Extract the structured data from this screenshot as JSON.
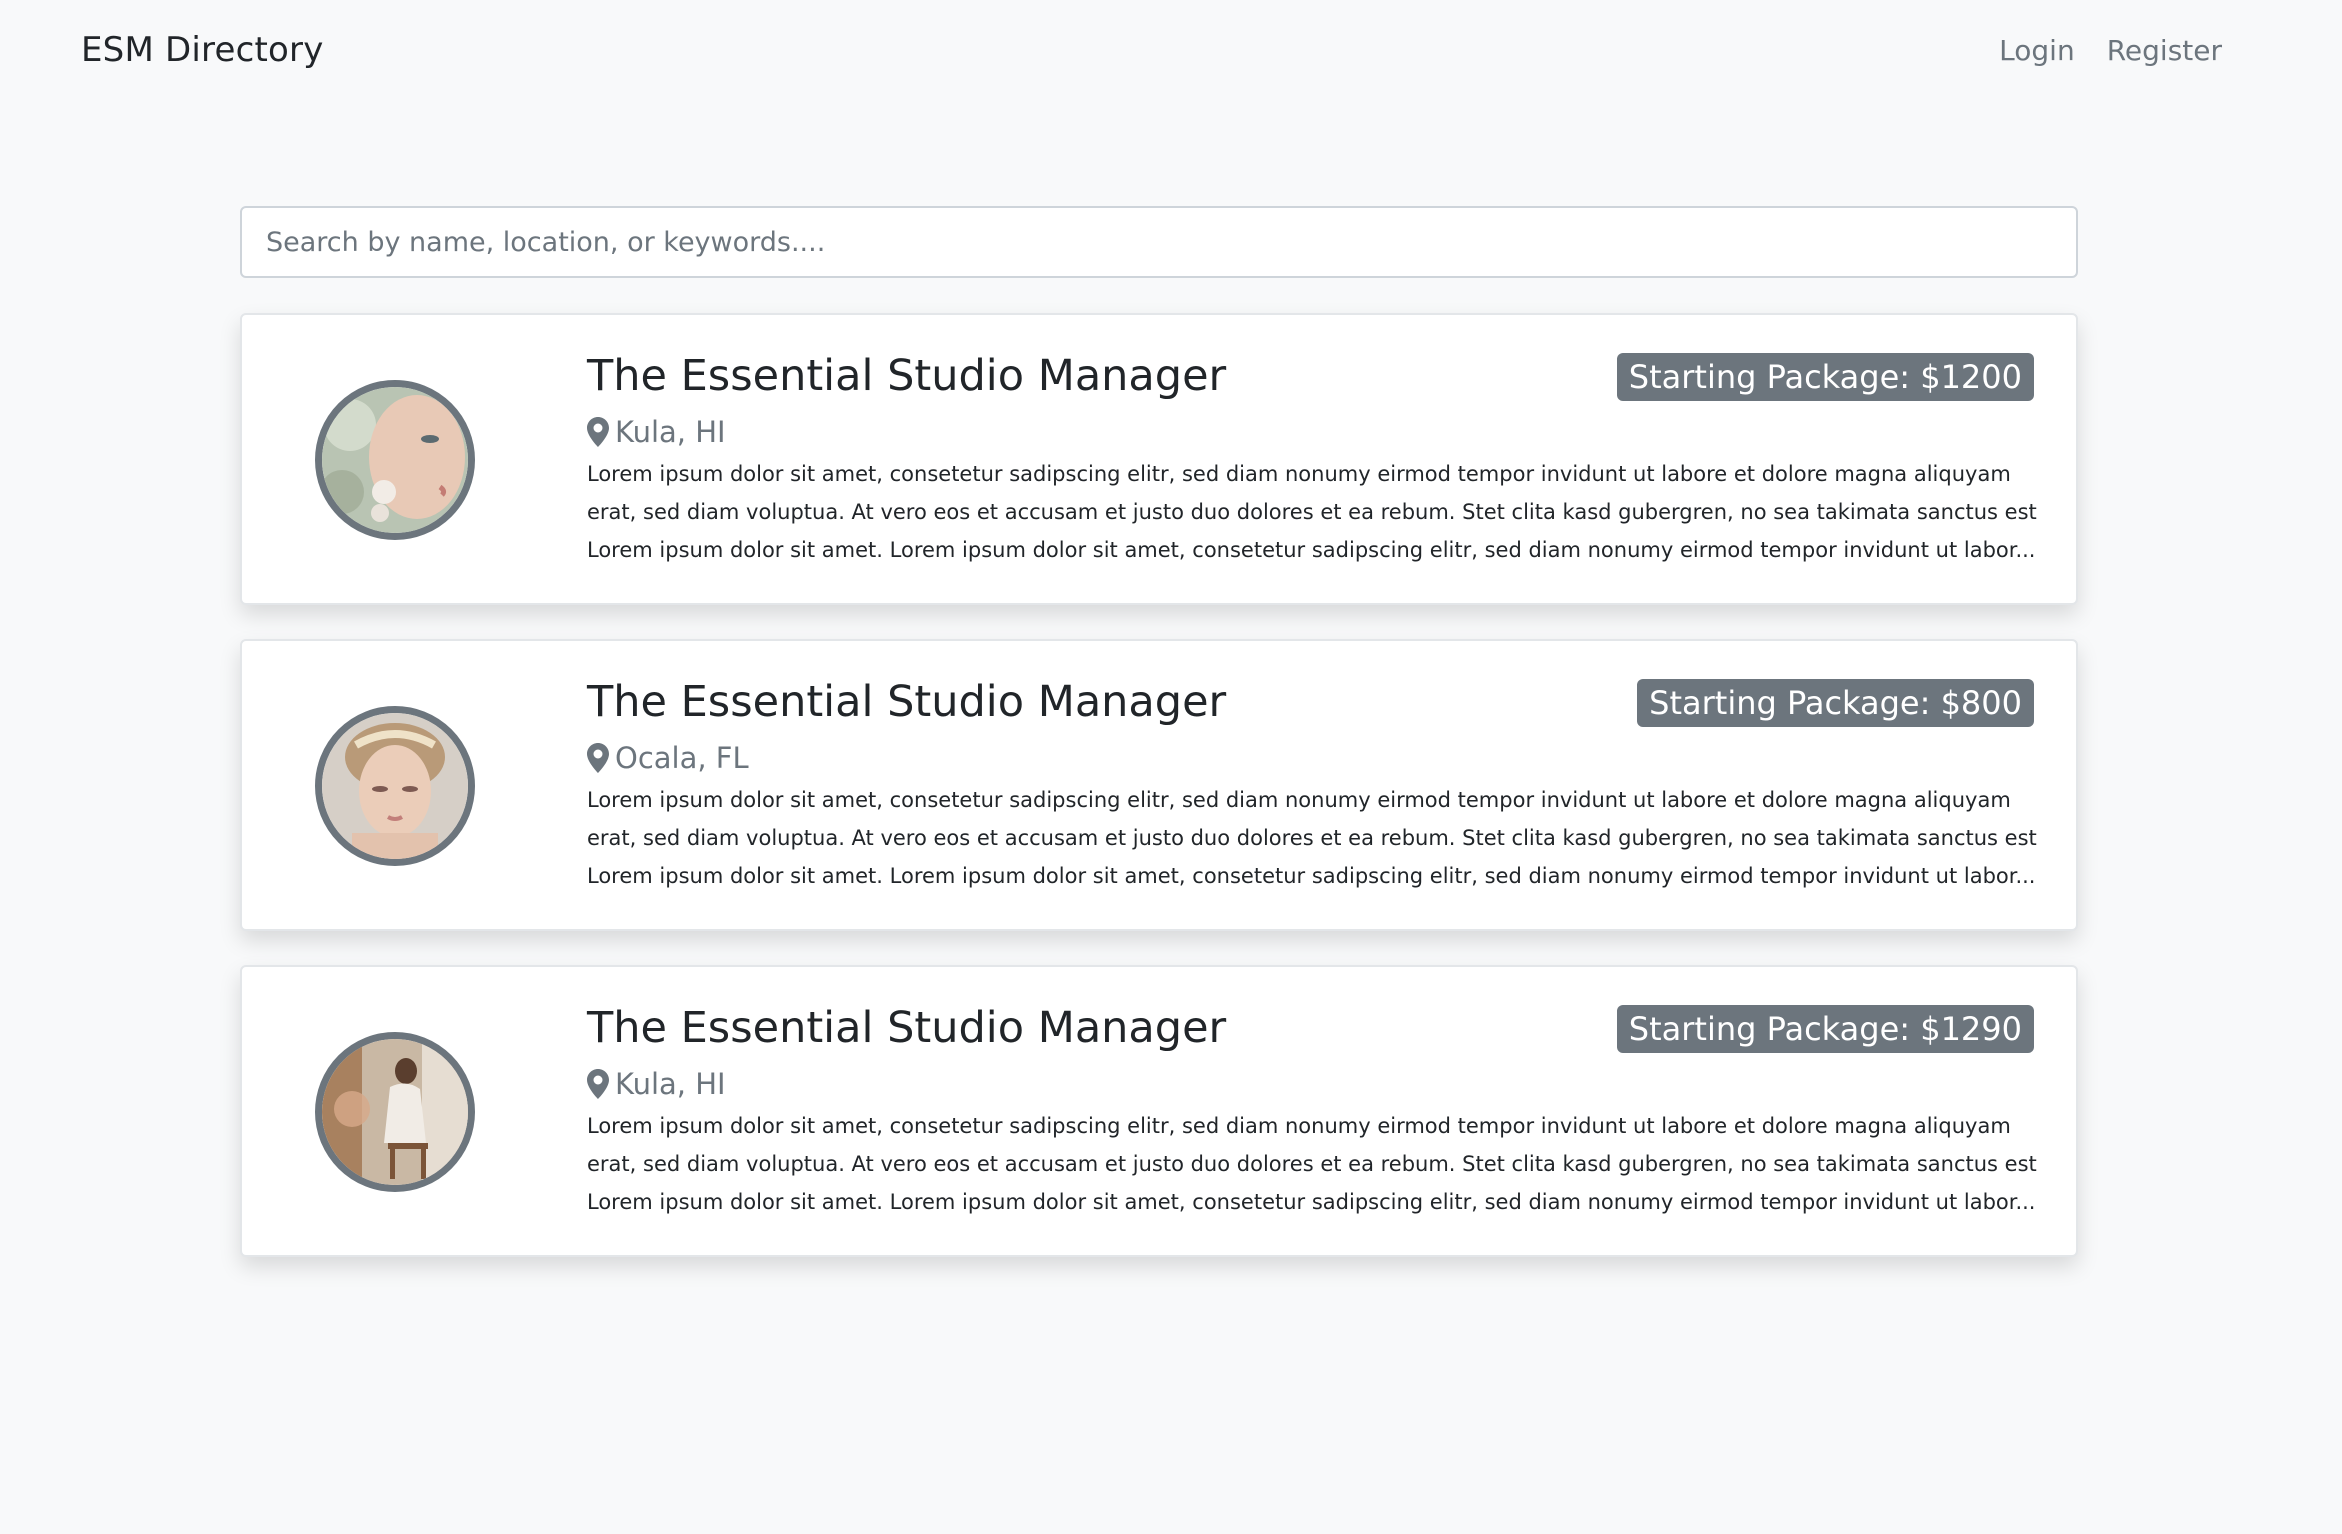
{
  "navbar": {
    "brand": "ESM Directory",
    "links": [
      "Login",
      "Register"
    ]
  },
  "search": {
    "placeholder": "Search by name, location, or keywords...."
  },
  "listings": [
    {
      "title": "The Essential Studio Manager",
      "package": "Starting Package: $1200",
      "location": "Kula, HI",
      "description": "Lorem ipsum dolor sit amet, consetetur sadipscing elitr, sed diam nonumy eirmod tempor invidunt ut labore et dolore magna aliquyam erat, sed diam voluptua. At vero eos et accusam et justo duo dolores et ea rebum. Stet clita kasd gubergren, no sea takimata sanctus est Lorem ipsum dolor sit amet. Lorem ipsum dolor sit amet, consetetur sadipscing elitr, sed diam nonumy eirmod tempor invidunt ut labor..."
    },
    {
      "title": "The Essential Studio Manager",
      "package": "Starting Package: $800",
      "location": "Ocala, FL",
      "description": "Lorem ipsum dolor sit amet, consetetur sadipscing elitr, sed diam nonumy eirmod tempor invidunt ut labore et dolore magna aliquyam erat, sed diam voluptua. At vero eos et accusam et justo duo dolores et ea rebum. Stet clita kasd gubergren, no sea takimata sanctus est Lorem ipsum dolor sit amet. Lorem ipsum dolor sit amet, consetetur sadipscing elitr, sed diam nonumy eirmod tempor invidunt ut labor..."
    },
    {
      "title": "The Essential Studio Manager",
      "package": "Starting Package: $1290",
      "location": "Kula, HI",
      "description": "Lorem ipsum dolor sit amet, consetetur sadipscing elitr, sed diam nonumy eirmod tempor invidunt ut labore et dolore magna aliquyam erat, sed diam voluptua. At vero eos et accusam et justo duo dolores et ea rebum. Stet clita kasd gubergren, no sea takimata sanctus est Lorem ipsum dolor sit amet. Lorem ipsum dolor sit amet, consetetur sadipscing elitr, sed diam nonumy eirmod tempor invidunt ut labor..."
    }
  ],
  "colors": {
    "background": "#f8f9fa",
    "badge": "#6c757d",
    "muted": "#6c757d",
    "text": "#212529"
  },
  "icons": {
    "location": "map-pin-icon"
  }
}
